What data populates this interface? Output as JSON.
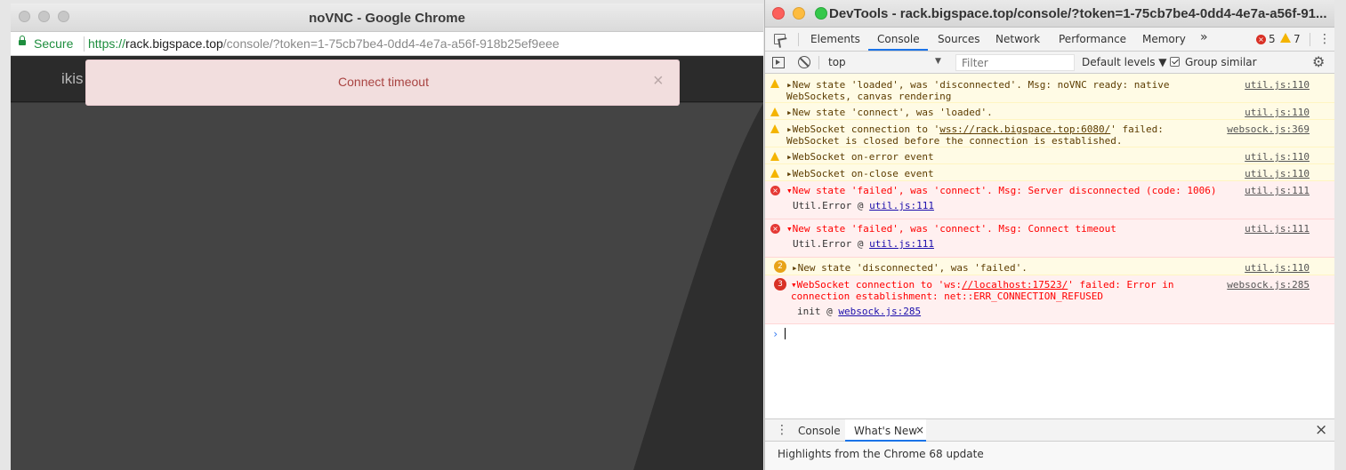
{
  "chrome": {
    "title": "noVNC - Google Chrome",
    "secure_label": "Secure",
    "url_scheme": "https://",
    "url_host": "rack.bigspace.top",
    "url_path": "/console/?token=1-75cb7be4-0dd4-4e7a-a56f-918b25ef9eee"
  },
  "novnc": {
    "header_text": "ikis",
    "banner_message": "Connect timeout",
    "banner_close": "×"
  },
  "devtools": {
    "title": "DevTools - rack.bigspace.top/console/?token=1-75cb7be4-0dd4-4e7a-a56f-91...",
    "tabs": [
      "Elements",
      "Console",
      "Sources",
      "Network",
      "Performance",
      "Memory"
    ],
    "more_tabs": "»",
    "error_count": "5",
    "warning_count": "7",
    "context": "top",
    "filter_placeholder": "Filter",
    "levels": "Default levels ▼",
    "group_similar": "Group similar",
    "messages": [
      {
        "level": "warning",
        "line1": "New state 'loaded', was 'disconnected'. Msg: noVNC ready: native",
        "line2": "WebSockets, canvas rendering",
        "source": "util.js:110"
      },
      {
        "level": "warning",
        "line1": "New state 'connect', was 'loaded'.",
        "source": "util.js:110"
      },
      {
        "level": "warning",
        "line1_pre": "WebSocket connection to '",
        "line1_link": "wss://rack.bigspace.top:6080/",
        "line1_post": "' failed:",
        "line2": "WebSocket is closed before the connection is established.",
        "source": "websock.js:369"
      },
      {
        "level": "warning",
        "line1": "WebSocket on-error event",
        "source": "util.js:110"
      },
      {
        "level": "warning",
        "line1": "WebSocket on-close event",
        "source": "util.js:110"
      },
      {
        "level": "error",
        "line1": "New state 'failed', was 'connect'. Msg: Server disconnected (code: 1006)",
        "trace_fn": "Util.Error @ ",
        "trace_src": "util.js:111",
        "source": "util.js:111"
      },
      {
        "level": "error",
        "line1": "New state 'failed', was 'connect'. Msg: Connect timeout",
        "trace_fn": "Util.Error @ ",
        "trace_src": "util.js:111",
        "source": "util.js:111"
      },
      {
        "level": "warning",
        "count": "2",
        "line1": "New state 'disconnected', was 'failed'.",
        "source": "util.js:110"
      },
      {
        "level": "error",
        "count": "3",
        "line1_pre": "WebSocket connection to 'ws:",
        "line1_link": "//localhost:17523/",
        "line1_post": "' failed: Error in",
        "line2": "connection establishment: net::ERR_CONNECTION_REFUSED",
        "trace_fn": "init @ ",
        "trace_src": "websock.js:285",
        "source": "websock.js:285"
      }
    ],
    "prompt": "›",
    "drawer": {
      "tabs": [
        "Console",
        "What's New"
      ],
      "close_tab": "×",
      "close_drawer": "×",
      "highlight": "Highlights from the Chrome 68 update"
    }
  }
}
